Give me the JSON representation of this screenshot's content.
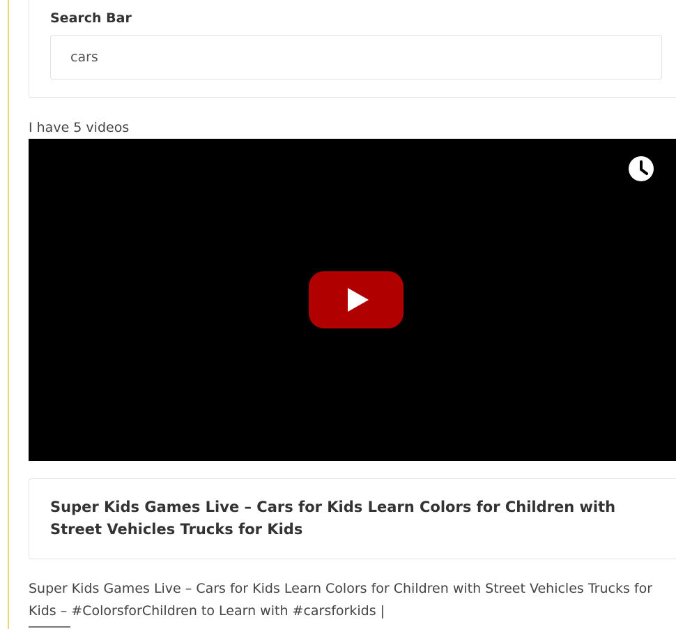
{
  "search": {
    "label": "Search Bar",
    "value": "cars"
  },
  "results": {
    "count_text": "I have 5 videos"
  },
  "video": {
    "title": "Super Kids Games Live – Cars for Kids Learn Colors for Children with Street Vehicles Trucks for Kids",
    "description": "Super Kids Games Live – Cars for Kids Learn Colors for Children with Street Vehicles Trucks for Kids – #ColorsforChildren to Learn with #carsforkids |"
  },
  "colors": {
    "accent_rule": "#f0d66a",
    "play_button": "#b00000",
    "player_background": "#000000"
  },
  "icons": {
    "watch_later": "clock-icon",
    "play": "play-icon"
  }
}
